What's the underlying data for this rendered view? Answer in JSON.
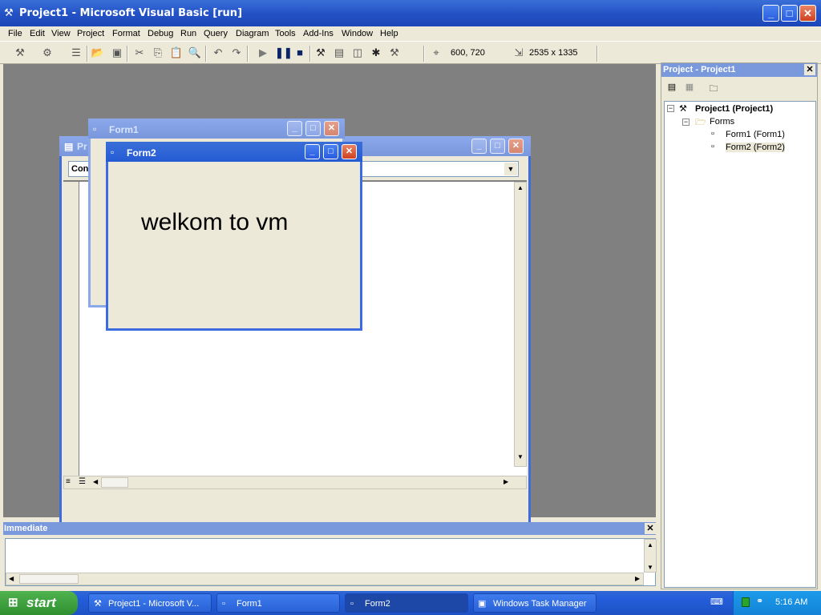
{
  "app": {
    "title": "Project1 - Microsoft Visual Basic [run]"
  },
  "menu": [
    "File",
    "Edit",
    "View",
    "Project",
    "Format",
    "Debug",
    "Run",
    "Query",
    "Diagram",
    "Tools",
    "Add-Ins",
    "Window",
    "Help"
  ],
  "toolbar": {
    "position_readout": "600, 720",
    "size_readout": "2535 x 1335"
  },
  "code_window": {
    "title_visible": "Pr",
    "object_combo": "Con"
  },
  "form1": {
    "title": "Form1"
  },
  "form2": {
    "title": "Form2",
    "label_text": "welkom to vm"
  },
  "project_panel": {
    "title": "Project - Project1",
    "root": "Project1 (Project1)",
    "folder": "Forms",
    "items": [
      "Form1 (Form1)",
      "Form2 (Form2)"
    ]
  },
  "immediate": {
    "title": "Immediate"
  },
  "taskbar": {
    "start_label": "start",
    "tasks": [
      "Project1 - Microsoft V...",
      "Form1",
      "Form2",
      "Windows Task Manager"
    ],
    "clock": "5:16 AM"
  },
  "colors": {
    "accent": "#245bd4",
    "mdi_background": "#808080",
    "taskbar": "#245edb",
    "start": "#3c9f3c"
  }
}
